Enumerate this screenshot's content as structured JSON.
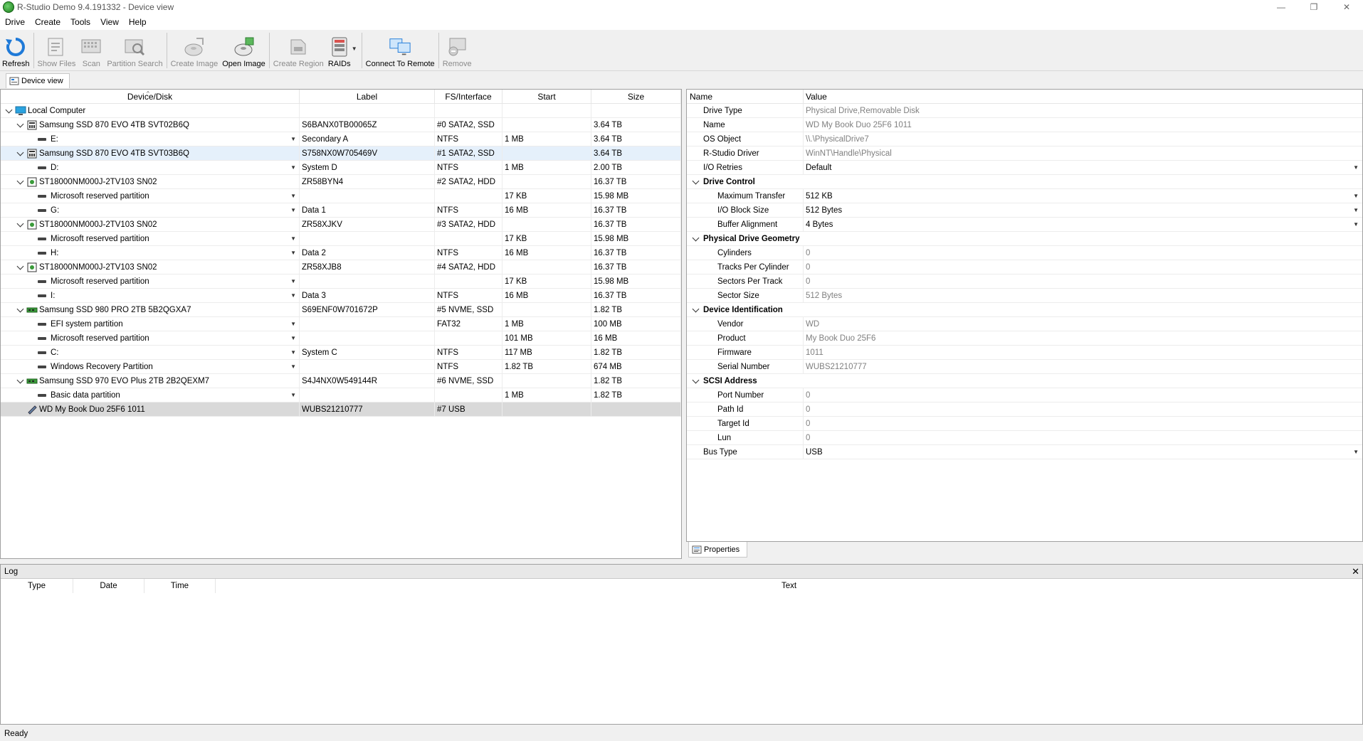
{
  "window": {
    "title": "R-Studio Demo 9.4.191332 - Device view",
    "minimize": "—",
    "maximize": "❐",
    "close": "✕"
  },
  "menu": [
    "Drive",
    "Create",
    "Tools",
    "View",
    "Help"
  ],
  "toolbar": {
    "refresh": "Refresh",
    "show_files": "Show Files",
    "scan": "Scan",
    "partition_search": "Partition Search",
    "create_image": "Create Image",
    "open_image": "Open Image",
    "create_region": "Create Region",
    "raids": "RAIDs",
    "connect_to_remote": "Connect To Remote",
    "remove": "Remove"
  },
  "tabs": {
    "device_view": "Device view",
    "properties": "Properties"
  },
  "device_table": {
    "headers": [
      "Device/Disk",
      "Label",
      "FS/Interface",
      "Start",
      "Size"
    ],
    "rows": [
      {
        "level": 0,
        "type": "computer",
        "name": "Local Computer",
        "label": "",
        "fs": "",
        "start": "",
        "size": ""
      },
      {
        "level": 1,
        "type": "ssd",
        "name": "Samsung SSD 870 EVO 4TB SVT02B6Q",
        "label": "S6BANX0TB00065Z",
        "fs": "#0 SATA2, SSD",
        "start": "",
        "size": "3.64 TB"
      },
      {
        "level": 2,
        "type": "part",
        "name": "E:",
        "label": "Secondary A",
        "fs": "NTFS",
        "start": "1 MB",
        "size": "3.64 TB"
      },
      {
        "level": 1,
        "type": "ssd",
        "name": "Samsung SSD 870 EVO 4TB SVT03B6Q",
        "label": "S758NX0W705469V",
        "fs": "#1 SATA2, SSD",
        "start": "",
        "size": "3.64 TB",
        "selected": true
      },
      {
        "level": 2,
        "type": "part",
        "name": "D:",
        "label": "System D",
        "fs": "NTFS",
        "start": "1 MB",
        "size": "2.00 TB"
      },
      {
        "level": 1,
        "type": "hdd",
        "name": "ST18000NM000J-2TV103 SN02",
        "label": "ZR58BYN4",
        "fs": "#2 SATA2, HDD",
        "start": "",
        "size": "16.37 TB"
      },
      {
        "level": 2,
        "type": "part",
        "name": "Microsoft reserved partition",
        "label": "",
        "fs": "",
        "start": "17 KB",
        "size": "15.98 MB"
      },
      {
        "level": 2,
        "type": "part",
        "name": "G:",
        "label": "Data 1",
        "fs": "NTFS",
        "start": "16 MB",
        "size": "16.37 TB"
      },
      {
        "level": 1,
        "type": "hdd",
        "name": "ST18000NM000J-2TV103 SN02",
        "label": "ZR58XJKV",
        "fs": "#3 SATA2, HDD",
        "start": "",
        "size": "16.37 TB"
      },
      {
        "level": 2,
        "type": "part",
        "name": "Microsoft reserved partition",
        "label": "",
        "fs": "",
        "start": "17 KB",
        "size": "15.98 MB"
      },
      {
        "level": 2,
        "type": "part",
        "name": "H:",
        "label": "Data 2",
        "fs": "NTFS",
        "start": "16 MB",
        "size": "16.37 TB"
      },
      {
        "level": 1,
        "type": "hdd",
        "name": "ST18000NM000J-2TV103 SN02",
        "label": "ZR58XJB8",
        "fs": "#4 SATA2, HDD",
        "start": "",
        "size": "16.37 TB"
      },
      {
        "level": 2,
        "type": "part",
        "name": "Microsoft reserved partition",
        "label": "",
        "fs": "",
        "start": "17 KB",
        "size": "15.98 MB"
      },
      {
        "level": 2,
        "type": "part",
        "name": "I:",
        "label": "Data 3",
        "fs": "NTFS",
        "start": "16 MB",
        "size": "16.37 TB"
      },
      {
        "level": 1,
        "type": "nvme",
        "name": "Samsung SSD 980 PRO 2TB 5B2QGXA7",
        "label": "S69ENF0W701672P",
        "fs": "#5 NVME, SSD",
        "start": "",
        "size": "1.82 TB"
      },
      {
        "level": 2,
        "type": "part",
        "name": "EFI system partition",
        "label": "",
        "fs": "FAT32",
        "start": "1 MB",
        "size": "100 MB"
      },
      {
        "level": 2,
        "type": "part",
        "name": "Microsoft reserved partition",
        "label": "",
        "fs": "",
        "start": "101 MB",
        "size": "16 MB"
      },
      {
        "level": 2,
        "type": "part",
        "name": "C:",
        "label": "System C",
        "fs": "NTFS",
        "start": "117 MB",
        "size": "1.82 TB"
      },
      {
        "level": 2,
        "type": "part",
        "name": "Windows Recovery Partition",
        "label": "",
        "fs": "NTFS",
        "start": "1.82 TB",
        "size": "674 MB"
      },
      {
        "level": 1,
        "type": "nvme",
        "name": "Samsung SSD 970 EVO Plus 2TB 2B2QEXM7",
        "label": "S4J4NX0W549144R",
        "fs": "#6 NVME, SSD",
        "start": "",
        "size": "1.82 TB"
      },
      {
        "level": 2,
        "type": "part",
        "name": "Basic data partition",
        "label": "",
        "fs": "",
        "start": "1 MB",
        "size": "1.82 TB"
      },
      {
        "level": 1,
        "type": "usb",
        "name": "WD My Book Duo 25F6 1011",
        "label": "WUBS21210777",
        "fs": "#7 USB",
        "start": "",
        "size": "",
        "focused": true
      }
    ]
  },
  "properties": {
    "headers": [
      "Name",
      "Value"
    ],
    "rows": [
      {
        "indent": 1,
        "name": "Drive Type",
        "value": "Physical Drive,Removable Disk",
        "grey": true
      },
      {
        "indent": 1,
        "name": "Name",
        "value": "WD My Book Duo 25F6 1011",
        "grey": true
      },
      {
        "indent": 1,
        "name": "OS Object",
        "value": "\\\\.\\PhysicalDrive7",
        "grey": true
      },
      {
        "indent": 1,
        "name": "R-Studio Driver",
        "value": "WinNT\\Handle\\Physical",
        "grey": true
      },
      {
        "indent": 1,
        "name": "I/O Retries",
        "value": "Default",
        "dropdown": true
      },
      {
        "group": true,
        "name": "Drive Control"
      },
      {
        "indent": 2,
        "name": "Maximum Transfer",
        "value": "512 KB",
        "dropdown": true
      },
      {
        "indent": 2,
        "name": "I/O Block Size",
        "value": "512 Bytes",
        "dropdown": true
      },
      {
        "indent": 2,
        "name": "Buffer Alignment",
        "value": "4 Bytes",
        "dropdown": true
      },
      {
        "group": true,
        "name": "Physical Drive Geometry"
      },
      {
        "indent": 2,
        "name": "Cylinders",
        "value": "0",
        "grey": true
      },
      {
        "indent": 2,
        "name": "Tracks Per Cylinder",
        "value": "0",
        "grey": true
      },
      {
        "indent": 2,
        "name": "Sectors Per Track",
        "value": "0",
        "grey": true
      },
      {
        "indent": 2,
        "name": "Sector Size",
        "value": "512 Bytes",
        "grey": true
      },
      {
        "group": true,
        "name": "Device Identification"
      },
      {
        "indent": 2,
        "name": "Vendor",
        "value": "WD",
        "grey": true
      },
      {
        "indent": 2,
        "name": "Product",
        "value": "My Book Duo 25F6",
        "grey": true
      },
      {
        "indent": 2,
        "name": "Firmware",
        "value": "1011",
        "grey": true
      },
      {
        "indent": 2,
        "name": "Serial Number",
        "value": "WUBS21210777",
        "grey": true
      },
      {
        "group": true,
        "name": "SCSI Address"
      },
      {
        "indent": 2,
        "name": "Port Number",
        "value": "0",
        "grey": true
      },
      {
        "indent": 2,
        "name": "Path Id",
        "value": "0",
        "grey": true
      },
      {
        "indent": 2,
        "name": "Target Id",
        "value": "0",
        "grey": true
      },
      {
        "indent": 2,
        "name": "Lun",
        "value": "0",
        "grey": true
      },
      {
        "indent": 1,
        "name": "Bus Type",
        "value": "USB",
        "dropdown": true
      }
    ]
  },
  "log": {
    "title": "Log",
    "close": "✕",
    "headers": [
      "Type",
      "Date",
      "Time",
      "Text"
    ]
  },
  "status": "Ready",
  "colors": {
    "selected_row": "#e5f0fb",
    "focused_row": "#d9d9d9",
    "refresh_icon": "#1f7ad8"
  },
  "icons": {
    "refresh": "refresh-icon",
    "show_files": "show-files-icon",
    "scan": "scan-icon",
    "partition_search": "partition-search-icon",
    "create_image": "create-image-icon",
    "open_image": "open-image-icon",
    "create_region": "create-region-icon",
    "raids": "raids-icon",
    "connect": "connect-remote-icon",
    "remove": "remove-icon"
  }
}
